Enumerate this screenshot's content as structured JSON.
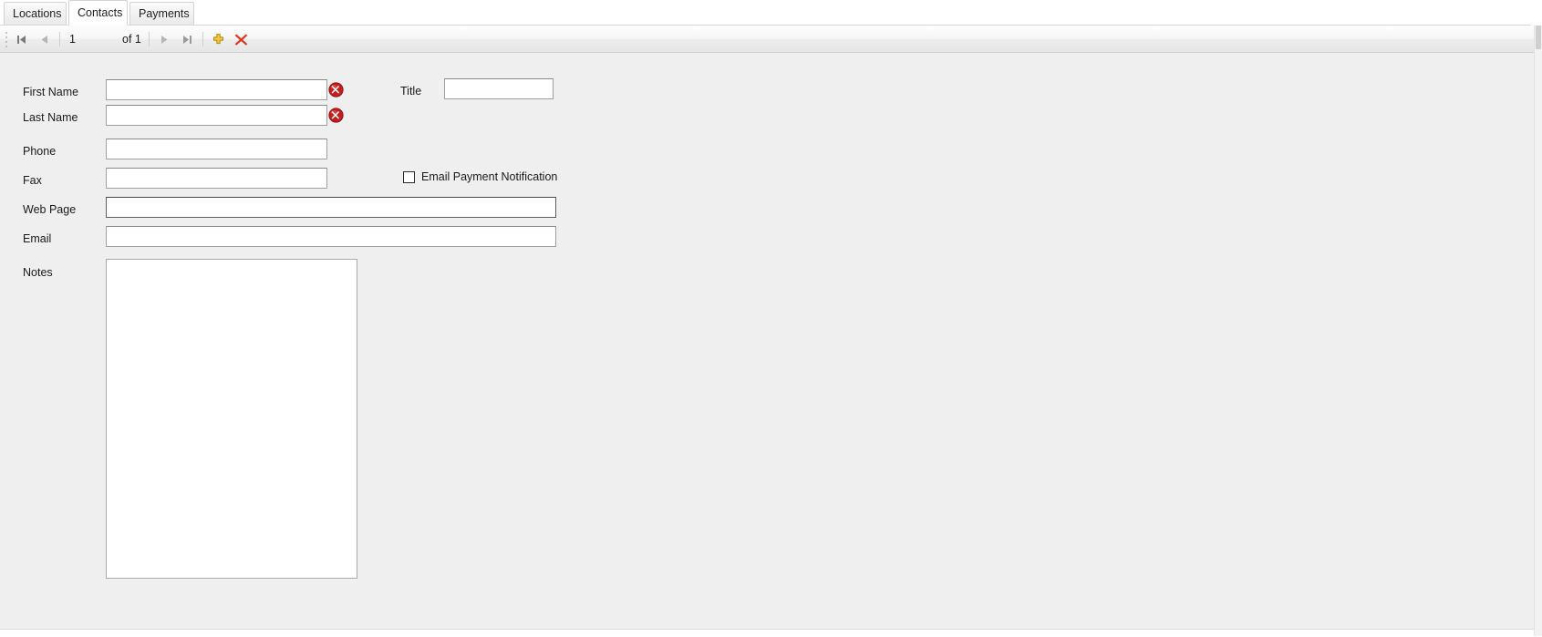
{
  "tabs": [
    {
      "label": "Locations",
      "selected": false
    },
    {
      "label": "Contacts",
      "selected": true
    },
    {
      "label": "Payments",
      "selected": false
    }
  ],
  "navigator": {
    "first_label": "first-record",
    "previous_label": "previous-record",
    "current_page": "1",
    "of_label": "of 1",
    "next_label": "next-record",
    "last_label": "last-record",
    "add_label": "add-record",
    "delete_label": "delete-record"
  },
  "form": {
    "first_name": {
      "label": "First Name",
      "value": "",
      "error": true
    },
    "last_name": {
      "label": "Last Name",
      "value": "",
      "error": true
    },
    "title": {
      "label": "Title",
      "value": ""
    },
    "phone": {
      "label": "Phone",
      "value": ""
    },
    "fax": {
      "label": "Fax",
      "value": ""
    },
    "web_page": {
      "label": "Web Page",
      "value": "",
      "focused": true
    },
    "email": {
      "label": "Email",
      "value": ""
    },
    "notes": {
      "label": "Notes",
      "value": ""
    },
    "email_payment_notification": {
      "label": "Email Payment Notification",
      "checked": false
    }
  },
  "colors": {
    "panel_background": "#efefef",
    "error_red": "#cc2222",
    "add_gold": "#f2c12e",
    "delete_red": "#e03223",
    "nav_arrow_gray": "#9a9a9a",
    "nav_arrow_dark": "#6e6e6e"
  }
}
